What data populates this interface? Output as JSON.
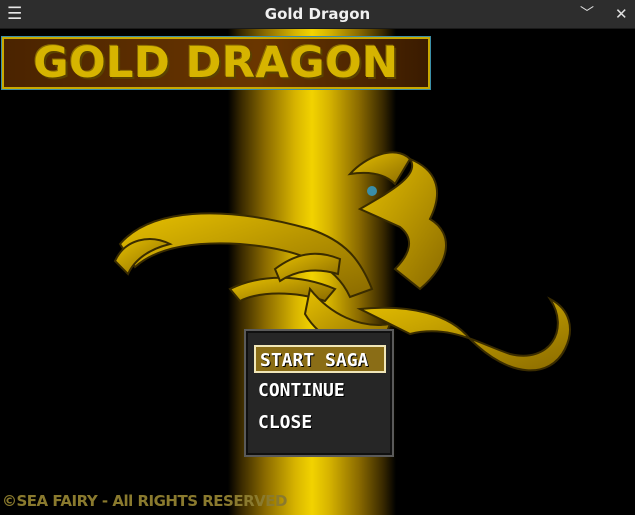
{
  "window": {
    "title": "Gold Dragon",
    "menu_icon": "☰",
    "chevron_icon": "﹀",
    "close_icon": "✕"
  },
  "game": {
    "logo_text": "GOLD DRAGON",
    "menu_items": [
      "START SAGA",
      "CONTINUE",
      "CLOSE"
    ],
    "selected_index": 0,
    "copyright": "©SEA FAIRY - All RIGHTS RESERVED"
  },
  "colors": {
    "gold": "#d6b400",
    "menu_bg": "#262626",
    "selected_bg": "#8a6d16"
  }
}
